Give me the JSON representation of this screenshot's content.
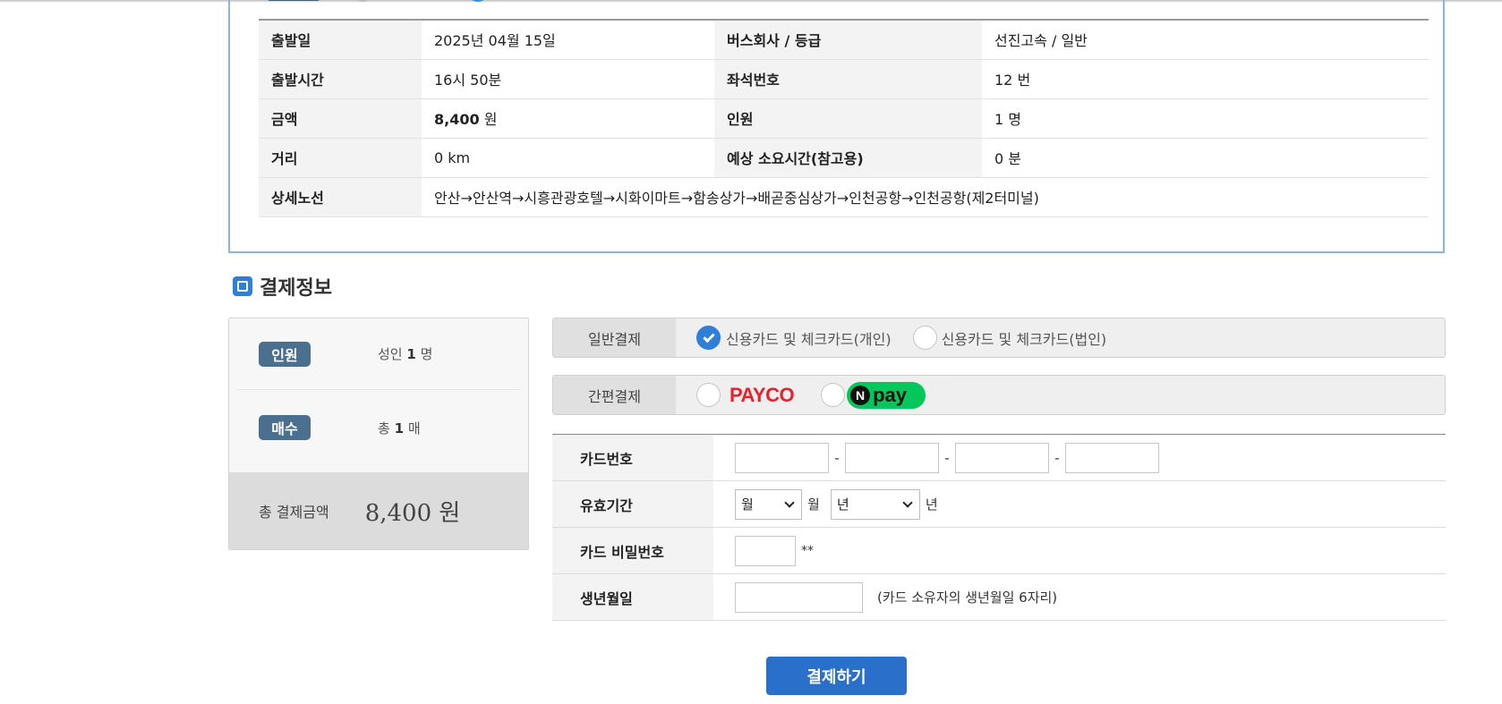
{
  "trip": {
    "rows": [
      {
        "l1": "출발일",
        "v1": "2025년 04월 15일",
        "l2": "버스회사 / 등급",
        "v2": "선진고속 / 일반"
      },
      {
        "l1": "출발시간",
        "v1": "16시 50분",
        "l2": "좌석번호",
        "v2": "12 번"
      },
      {
        "l1": "금액",
        "v1_amount": "8,400",
        "v1_unit": "원",
        "l2": "인원",
        "v2": "1 명"
      },
      {
        "l1": "거리",
        "v1": "0 km",
        "l2": "예상 소요시간(참고용)",
        "v2": "0 분"
      }
    ],
    "route_label": "상세노선",
    "route_value": "안산→안산역→시흥관광호텔→시화이마트→함송상가→배곧중심상가→인천공항→인천공항(제2터미널)"
  },
  "section": {
    "title": "결제정보",
    "icon": "bus-icon"
  },
  "summary": {
    "people_badge": "인원",
    "people_prefix": "성인",
    "people_count": "1",
    "people_unit": "명",
    "tickets_badge": "매수",
    "tickets_prefix": "총",
    "tickets_count": "1",
    "tickets_unit": "매",
    "total_label": "총 결제금액",
    "total_amount": "8,400 원"
  },
  "payment": {
    "general_label": "일반결제",
    "option_personal": "신용카드 및 체크카드(개인)",
    "option_corporate": "신용카드 및 체크카드(법인)",
    "selected": "personal",
    "easy_label": "간편결제",
    "payco": "PAYCO",
    "npay_n": "N",
    "npay": "pay"
  },
  "card_form": {
    "card_number_label": "카드번호",
    "dash": "-",
    "expiry_label": "유효기간",
    "month_select": "월",
    "month_unit": "월",
    "year_select": "년",
    "year_unit": "년",
    "password_label": "카드 비밀번호",
    "password_suffix": "**",
    "birth_label": "생년월일",
    "birth_note": "(카드 소유자의 생년월일 6자리)"
  },
  "submit_label": "결제하기",
  "colors": {
    "accent": "#2f7fd8",
    "button": "#2a6fc9",
    "badge": "#4a6f8f",
    "box_border": "#86b5e6"
  }
}
